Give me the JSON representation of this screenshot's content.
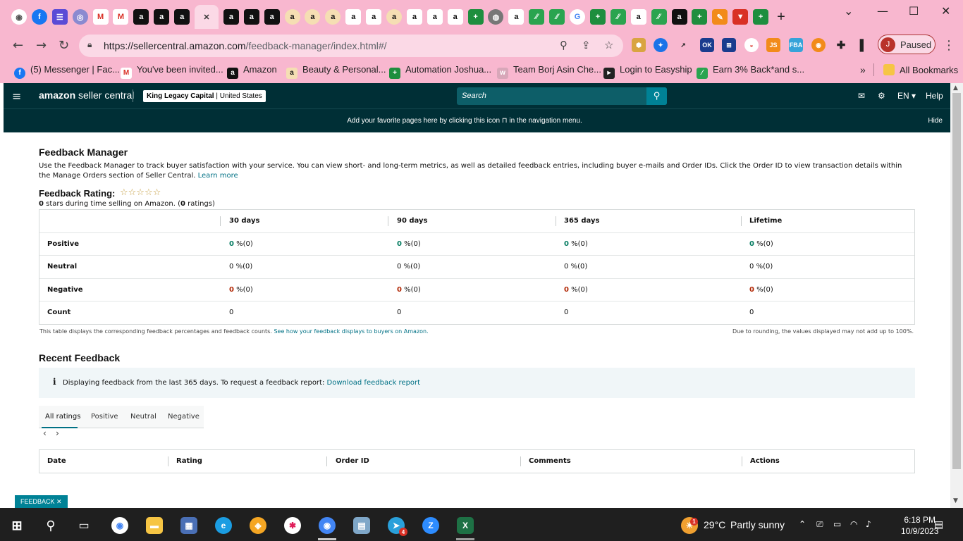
{
  "browser": {
    "url_host": "https://sellercentral.amazon.com",
    "url_path": "/feedback-manager/index.html#/",
    "profile_initial": "J",
    "profile_label": "Paused",
    "bookmarks": [
      {
        "label": "(5) Messenger | Fac...",
        "icon": "messenger-icon",
        "color": "#1877f2"
      },
      {
        "label": "You've been invited...",
        "icon": "gmail-icon",
        "color": "#d93025"
      },
      {
        "label": "Amazon",
        "icon": "amazon-icon",
        "color": "#111111"
      },
      {
        "label": "Beauty & Personal...",
        "icon": "amazon-smile-icon",
        "color": "#f5deb3"
      },
      {
        "label": "Automation Joshua...",
        "icon": "sheets-icon",
        "color": "#1e8e3e"
      },
      {
        "label": "Team Borj Asin Che...",
        "icon": "team-icon",
        "color": "#d8a7b9"
      },
      {
        "label": "Login to Easyship",
        "icon": "easyship-icon",
        "color": "#222222"
      },
      {
        "label": "Earn 3% Back*and s...",
        "icon": "earn-icon",
        "color": "#2aa44f"
      }
    ],
    "all_bookmarks": "All Bookmarks"
  },
  "seller": {
    "logo_word": "amazon",
    "logo_rest": "seller central",
    "account_name": "King Legacy Capital",
    "account_region": "United States",
    "search_placeholder": "Search",
    "lang": "EN",
    "help": "Help",
    "banner_text": "Add your favorite pages here by clicking this icon ⊓ in the navigation menu.",
    "banner_hide": "Hide"
  },
  "page": {
    "title": "Feedback Manager",
    "description": "Use the Feedback Manager to track buyer satisfaction with your service. You can view short- and long-term metrics, as well as detailed feedback entries, including buyer e-mails and Order IDs. Click the Order ID to view transaction details within the Manage Orders section of Seller Central.",
    "learn_more": "Learn more",
    "rating_title": "Feedback Rating:",
    "stars": "☆☆☆☆☆",
    "rating_stars_value": "0",
    "rating_text_mid": "stars during time selling on Amazon. (",
    "rating_count": "0",
    "rating_text_end": "ratings)",
    "metrics": {
      "headers": [
        "",
        "30 days",
        "90 days",
        "365 days",
        "Lifetime"
      ],
      "rows": [
        {
          "label": "Positive",
          "values": [
            "0",
            "0",
            "0",
            "0"
          ],
          "suffix": "%(0)"
        },
        {
          "label": "Neutral",
          "values": [
            "0",
            "0",
            "0",
            "0"
          ],
          "suffix": "%(0)"
        },
        {
          "label": "Negative",
          "values": [
            "0",
            "0",
            "0",
            "0"
          ],
          "suffix": "%(0)"
        },
        {
          "label": "Count",
          "values": [
            "0",
            "0",
            "0",
            "0"
          ],
          "suffix": ""
        }
      ]
    },
    "table_note": "This table displays the corresponding feedback percentages and feedback counts.",
    "table_note_link": "See how your feedback displays to buyers on Amazon.",
    "rounding_note": "Due to rounding, the values displayed may not add up to 100%.",
    "recent_title": "Recent Feedback",
    "info_text": "Displaying feedback from the last 365 days. To request a feedback report:",
    "info_link": "Download feedback report",
    "tabs": [
      "All ratings",
      "Positive",
      "Neutral",
      "Negative"
    ],
    "feedback_columns": [
      "Date",
      "Rating",
      "Order ID",
      "Comments",
      "Actions"
    ],
    "feedback_button": "FEEDBACK"
  },
  "taskbar": {
    "weather_temp": "29°C",
    "weather_text": "Partly sunny",
    "time": "6:18 PM",
    "date": "10/9/2023",
    "weather_badge": "1",
    "telegram_badge": "4"
  }
}
